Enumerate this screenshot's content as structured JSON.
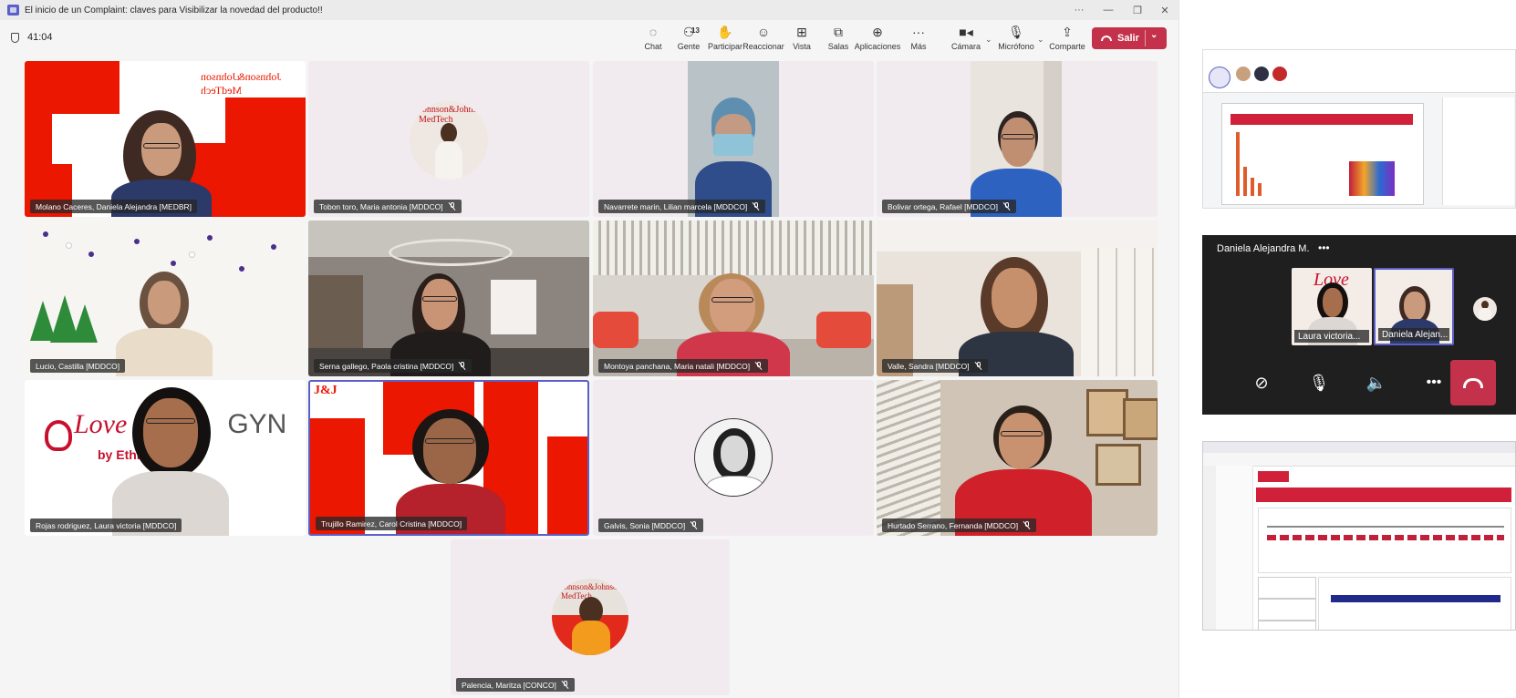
{
  "window": {
    "title": "El inicio de un Complaint: claves para Visibilizar la novedad del producto!!",
    "controls": [
      "···",
      "—",
      "❐",
      "✕"
    ]
  },
  "meeting": {
    "timer": "41:04",
    "toolbar": {
      "chat": "Chat",
      "people": "Gente",
      "people_count": "13",
      "raise": "Participar",
      "react": "Reaccionar",
      "view": "Vista",
      "rooms": "Salas",
      "apps": "Aplicaciones",
      "more": "Más",
      "camera": "Cámara",
      "mic": "Micrófono",
      "share": "Comparte",
      "leave": "Salir"
    }
  },
  "participants": [
    {
      "name": "Molano Caceres, Daniela Alejandra [MEDBR]",
      "muted": false
    },
    {
      "name": "Tobon toro, Maria antonia [MDDCO]",
      "muted": true
    },
    {
      "name": "Navarrete marin, Lilian marcela [MDDCO]",
      "muted": true
    },
    {
      "name": "Bolivar ortega, Rafael [MDDCO]",
      "muted": true
    },
    {
      "name": "Lucio, Castilla [MDDCO]",
      "muted": false
    },
    {
      "name": "Serna gallego, Paola cristina [MDDCO]",
      "muted": true
    },
    {
      "name": "Montoya panchana, Maria natali [MDDCO]",
      "muted": true
    },
    {
      "name": "Valle, Sandra [MDDCO]",
      "muted": true
    },
    {
      "name": "Rojas rodriguez, Laura victoria [MDDCO]",
      "muted": false
    },
    {
      "name": "Trujillo Ramirez, Carol Cristina [MDDCO]",
      "muted": false
    },
    {
      "name": "Galvis, Sonia [MDDCO]",
      "muted": true
    },
    {
      "name": "Hurtado Serrano, Fernanda [MDDCO]",
      "muted": true
    },
    {
      "name": "Palencia, Maritza [CONCO]",
      "muted": true
    }
  ],
  "backgrounds": {
    "jnj_logo": "Johnson&Johnson MedTech",
    "jj_short": "J&J",
    "lovegyn_main": "Love",
    "lovegyn_gyn": "GYN",
    "lovegyn_by": "by Ethicon"
  },
  "call_window": {
    "title": "Daniela Alejandra M.",
    "thumbs": [
      "Laura victoria...",
      "Daniela Alejan..."
    ]
  },
  "colors": {
    "teams_purple": "#5b5fc7",
    "leave_red": "#c4314b",
    "jnj_red": "#eb1700",
    "call_bg": "#1f1f1f"
  }
}
